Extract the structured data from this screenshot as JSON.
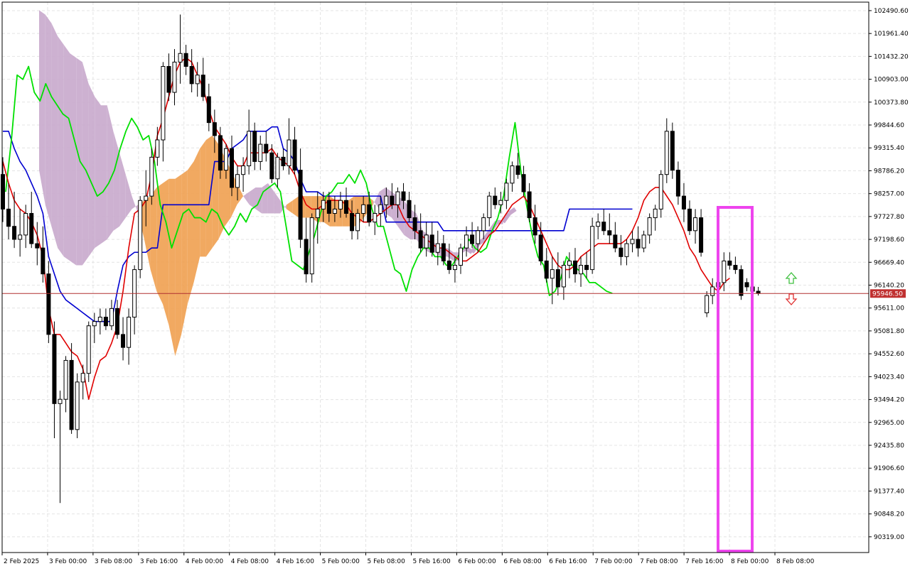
{
  "chart_data": {
    "type": "candlestick",
    "title": "",
    "xlabel": "",
    "ylabel": "",
    "ylim": [
      89955,
      102687
    ],
    "grid": true,
    "y_tick_labels": [
      "102490.60",
      "101961.40",
      "101432.20",
      "100903.00",
      "100373.80",
      "99844.60",
      "99315.40",
      "98786.20",
      "98257.00",
      "97727.80",
      "97198.60",
      "96669.40",
      "96140.20",
      "95611.00",
      "95081.80",
      "94552.60",
      "94023.40",
      "93494.20",
      "92965.00",
      "92435.80",
      "91906.60",
      "91377.40",
      "90848.20",
      "90319.00"
    ],
    "x_tick_labels": [
      "2 Feb 2025",
      "3 Feb 00:00",
      "3 Feb 08:00",
      "3 Feb 16:00",
      "4 Feb 00:00",
      "4 Feb 08:00",
      "4 Feb 16:00",
      "5 Feb 00:00",
      "5 Feb 08:00",
      "5 Feb 16:00",
      "6 Feb 00:00",
      "6 Feb 08:00",
      "6 Feb 16:00",
      "7 Feb 00:00",
      "7 Feb 08:00",
      "7 Feb 16:00",
      "8 Feb 00:00",
      "8 Feb 08:00"
    ],
    "current_price_label": "95946.50",
    "current_price": 95946.5,
    "colors": {
      "tenkan": "#e00000",
      "kijun": "#0000d0",
      "chikou": "#00e000",
      "kumo_bearish": "#c8a8cc",
      "kumo_bullish": "#f0a050",
      "price_line": "#b03030",
      "highlight_box": "#ee44ee",
      "arrow_up": "#40c040",
      "arrow_down": "#e03030",
      "candle_down": "#000000",
      "candle_up": "#ffffff"
    },
    "candles": [
      [
        98700,
        99100,
        97600,
        97900
      ],
      [
        97900,
        98500,
        97200,
        97500
      ],
      [
        97500,
        98300,
        97000,
        97200
      ],
      [
        97200,
        97900,
        96800,
        97300
      ],
      [
        97300,
        98000,
        97000,
        97800
      ],
      [
        97800,
        98300,
        97000,
        97100
      ],
      [
        97100,
        97600,
        96600,
        97000
      ],
      [
        97000,
        97500,
        96200,
        96400
      ],
      [
        96400,
        96700,
        94800,
        95000
      ],
      [
        95000,
        95300,
        92600,
        93400
      ],
      [
        93400,
        93700,
        91100,
        93500
      ],
      [
        93500,
        94500,
        93200,
        94400
      ],
      [
        94400,
        94800,
        92700,
        92800
      ],
      [
        92800,
        94100,
        92600,
        93900
      ],
      [
        93900,
        94300,
        93500,
        94100
      ],
      [
        94100,
        95300,
        93900,
        95200
      ],
      [
        95200,
        95500,
        94800,
        95300
      ],
      [
        95300,
        95600,
        95000,
        95400
      ],
      [
        95400,
        95600,
        95100,
        95200
      ],
      [
        95200,
        95800,
        95100,
        95600
      ],
      [
        95600,
        95800,
        94900,
        95000
      ],
      [
        95000,
        95400,
        94400,
        94700
      ],
      [
        94700,
        95600,
        94300,
        95400
      ],
      [
        95400,
        96600,
        95000,
        96500
      ],
      [
        96500,
        98200,
        96300,
        98100
      ],
      [
        98100,
        98800,
        97500,
        98200
      ],
      [
        98200,
        99300,
        98000,
        99100
      ],
      [
        99100,
        99800,
        98900,
        99500
      ],
      [
        99500,
        101300,
        99000,
        101200
      ],
      [
        101200,
        101500,
        100400,
        100600
      ],
      [
        100600,
        101600,
        100300,
        101300
      ],
      [
        101300,
        102400,
        100800,
        101500
      ],
      [
        101500,
        101700,
        101000,
        101200
      ],
      [
        101200,
        101600,
        100600,
        100800
      ],
      [
        100800,
        101300,
        100500,
        101000
      ],
      [
        101000,
        101400,
        100400,
        100500
      ],
      [
        100500,
        100800,
        99700,
        99900
      ],
      [
        99900,
        100200,
        99200,
        99600
      ],
      [
        99600,
        99800,
        98600,
        98800
      ],
      [
        98800,
        99400,
        98600,
        99300
      ],
      [
        99300,
        99600,
        98200,
        98400
      ],
      [
        98400,
        98900,
        98100,
        98700
      ],
      [
        98700,
        99100,
        98300,
        98900
      ],
      [
        98900,
        100200,
        98700,
        99700
      ],
      [
        99700,
        99900,
        98800,
        99000
      ],
      [
        99000,
        99600,
        98800,
        99400
      ],
      [
        99400,
        99700,
        99000,
        99200
      ],
      [
        99200,
        99400,
        98500,
        98600
      ],
      [
        98600,
        99200,
        98400,
        99100
      ],
      [
        99100,
        99300,
        98800,
        98900
      ],
      [
        98900,
        100000,
        98700,
        99500
      ],
      [
        99500,
        99800,
        98700,
        98800
      ],
      [
        98800,
        99300,
        97000,
        97200
      ],
      [
        97200,
        97700,
        96200,
        96400
      ],
      [
        96400,
        97800,
        96200,
        97700
      ],
      [
        97700,
        98300,
        97100,
        97900
      ],
      [
        97900,
        98300,
        97600,
        98100
      ],
      [
        98100,
        98300,
        97600,
        97800
      ],
      [
        97800,
        98200,
        97600,
        97900
      ],
      [
        97900,
        98300,
        97700,
        98100
      ],
      [
        98100,
        98400,
        97700,
        97800
      ],
      [
        97800,
        98100,
        97200,
        97400
      ],
      [
        97400,
        97900,
        97200,
        97800
      ],
      [
        97800,
        98200,
        97600,
        98000
      ],
      [
        98000,
        98300,
        97500,
        97600
      ],
      [
        97600,
        98000,
        97300,
        97800
      ],
      [
        97800,
        98200,
        97500,
        98000
      ],
      [
        98000,
        98400,
        97700,
        98200
      ],
      [
        98200,
        98500,
        97900,
        98000
      ],
      [
        98000,
        98400,
        97700,
        98300
      ],
      [
        98300,
        98500,
        97900,
        98100
      ],
      [
        98100,
        98300,
        97600,
        97700
      ],
      [
        97700,
        98000,
        97200,
        97400
      ],
      [
        97400,
        97800,
        96900,
        97000
      ],
      [
        97000,
        97600,
        96800,
        97300
      ],
      [
        97300,
        97600,
        96800,
        96900
      ],
      [
        96900,
        97400,
        96600,
        97100
      ],
      [
        97100,
        97300,
        96600,
        96700
      ],
      [
        96700,
        97100,
        96400,
        96500
      ],
      [
        96500,
        96800,
        96200,
        96600
      ],
      [
        96600,
        97100,
        96400,
        97000
      ],
      [
        97000,
        97500,
        96800,
        97300
      ],
      [
        97300,
        97600,
        97000,
        97100
      ],
      [
        97100,
        97500,
        96900,
        97400
      ],
      [
        97400,
        97800,
        97200,
        97700
      ],
      [
        97700,
        98300,
        97500,
        98200
      ],
      [
        98200,
        98400,
        97900,
        98000
      ],
      [
        98000,
        98300,
        97800,
        98100
      ],
      [
        98100,
        98600,
        97900,
        98500
      ],
      [
        98500,
        99000,
        98300,
        98900
      ],
      [
        98900,
        99200,
        98600,
        98700
      ],
      [
        98700,
        98900,
        98200,
        98300
      ],
      [
        98300,
        98500,
        97600,
        97700
      ],
      [
        97700,
        98000,
        97100,
        97300
      ],
      [
        97300,
        97600,
        96600,
        96700
      ],
      [
        96700,
        97000,
        96200,
        96300
      ],
      [
        96300,
        96800,
        95700,
        96500
      ],
      [
        96500,
        96900,
        95900,
        96100
      ],
      [
        96100,
        96700,
        95800,
        96600
      ],
      [
        96600,
        96900,
        96300,
        96700
      ],
      [
        96700,
        97000,
        96200,
        96400
      ],
      [
        96400,
        96800,
        96100,
        96600
      ],
      [
        96600,
        96900,
        96300,
        96500
      ],
      [
        96500,
        97700,
        96400,
        97500
      ],
      [
        97500,
        97800,
        97200,
        97600
      ],
      [
        97600,
        97900,
        97300,
        97400
      ],
      [
        97400,
        97800,
        97100,
        97300
      ],
      [
        97300,
        97600,
        96900,
        97000
      ],
      [
        97000,
        97300,
        96600,
        96800
      ],
      [
        96800,
        97200,
        96600,
        97100
      ],
      [
        97100,
        97400,
        96900,
        97200
      ],
      [
        97200,
        97500,
        96800,
        97000
      ],
      [
        97000,
        97400,
        96900,
        97300
      ],
      [
        97300,
        97800,
        97100,
        97700
      ],
      [
        97700,
        98000,
        97400,
        97900
      ],
      [
        97900,
        98800,
        97700,
        98700
      ],
      [
        98700,
        100000,
        98500,
        99700
      ],
      [
        99700,
        99900,
        98600,
        98800
      ],
      [
        98800,
        99000,
        98000,
        98200
      ],
      [
        98200,
        98500,
        97600,
        97900
      ],
      [
        97900,
        98100,
        97300,
        97400
      ],
      [
        97400,
        97900,
        97100,
        97700
      ],
      [
        97700,
        97900,
        96800,
        96900
      ],
      [
        95500,
        96000,
        95400,
        95900
      ],
      [
        95900,
        96300,
        95700,
        96100
      ],
      [
        96100,
        96400,
        95900,
        96200
      ],
      [
        96200,
        96900,
        96000,
        96700
      ],
      [
        96700,
        96900,
        96500,
        96600
      ],
      [
        96600,
        96800,
        96400,
        96500
      ],
      [
        96500,
        96600,
        95800,
        95900
      ],
      [
        96200,
        96300,
        96000,
        96100
      ],
      [
        96100,
        96200,
        95900,
        96000
      ],
      [
        96000,
        96100,
        95900,
        95950
      ]
    ],
    "tenkan": [
      99000,
      98500,
      98100,
      97900,
      97800,
      97600,
      97300,
      96800,
      95600,
      95000,
      95000,
      94800,
      94600,
      94500,
      94200,
      93500,
      94000,
      94400,
      94500,
      94800,
      95200,
      96000,
      97000,
      97800,
      97900,
      98100,
      98700,
      99600,
      100000,
      100500,
      101000,
      101300,
      101400,
      101300,
      101000,
      100700,
      100200,
      99800,
      99600,
      99400,
      99100,
      98900,
      98900,
      99200,
      99200,
      99200,
      99200,
      99300,
      99100,
      99000,
      98900,
      98700,
      98300,
      98000,
      97900,
      97900,
      98000,
      98100,
      98100,
      98100,
      98000,
      97800,
      97700,
      97600,
      97600,
      97700,
      97800,
      97900,
      98000,
      98000,
      97700,
      97500,
      97400,
      97300,
      97200,
      97100,
      97000,
      97000,
      96900,
      96800,
      96700,
      96700,
      96800,
      96900,
      97100,
      97300,
      97400,
      97600,
      97800,
      98000,
      98100,
      98200,
      98000,
      97700,
      97400,
      97100,
      96800,
      96600,
      96500,
      96500,
      96600,
      96800,
      96900,
      97000,
      97100,
      97100,
      97100,
      97100,
      97100,
      97200,
      97400,
      97700,
      98100,
      98300,
      98400,
      98400,
      98200,
      98000,
      97700,
      97400,
      97000,
      96800,
      96500,
      96300,
      96100,
      96000,
      96200,
      96300
    ],
    "kijun": [
      99700,
      99700,
      99300,
      99000,
      98800,
      98500,
      98200,
      97800,
      96800,
      96400,
      96000,
      95800,
      95700,
      95600,
      95500,
      95400,
      95300,
      95300,
      95300,
      95300,
      96000,
      96600,
      96800,
      96900,
      96900,
      96900,
      97000,
      97000,
      98000,
      98000,
      98000,
      98000,
      98000,
      98000,
      98000,
      98000,
      98000,
      99000,
      99000,
      99000,
      99300,
      99400,
      99500,
      99700,
      99700,
      99700,
      99700,
      99800,
      99800,
      99300,
      99200,
      99000,
      98600,
      98300,
      98300,
      98300,
      98200,
      98200,
      98200,
      98200,
      98200,
      98200,
      98200,
      98200,
      98200,
      98200,
      98200,
      97600,
      97600,
      97600,
      97600,
      97600,
      97600,
      97600,
      97600,
      97600,
      97600,
      97400,
      97400,
      97400,
      97400,
      97400,
      97400,
      97400,
      97400,
      97400,
      97400,
      97400,
      97400,
      97400,
      97400,
      97400,
      97400,
      97400,
      97400,
      97400,
      97400,
      97400,
      97400,
      97900,
      97900,
      97900,
      97900,
      97900,
      97900,
      97900,
      97900,
      97900,
      97900,
      97900,
      97900
    ],
    "chikou": [
      98300,
      99500,
      101000,
      100900,
      101200,
      100600,
      100400,
      100800,
      100500,
      100300,
      100100,
      100000,
      99500,
      99000,
      98800,
      98500,
      98200,
      98300,
      98500,
      98800,
      99300,
      99700,
      100000,
      99800,
      99500,
      99600,
      99000,
      98000,
      97600,
      97000,
      97400,
      97800,
      97900,
      97700,
      97700,
      97600,
      97900,
      97800,
      97500,
      97300,
      97500,
      97800,
      97600,
      97900,
      98000,
      98300,
      98400,
      98500,
      98300,
      97500,
      96700,
      96600,
      96500,
      96900,
      97300,
      97800,
      98200,
      98300,
      98500,
      98500,
      98700,
      98500,
      98800,
      98500,
      97900,
      97500,
      97500,
      97000,
      96500,
      96400,
      96000,
      96500,
      96800,
      97000,
      97000,
      96800,
      96800,
      96600,
      96600,
      96800,
      97000,
      97200,
      97000,
      96900,
      97000,
      97400,
      97700,
      98200,
      99100,
      99900,
      98800,
      98000,
      97300,
      96800,
      96600,
      95900,
      96000,
      96300,
      96800,
      96600,
      96500,
      96400,
      96200,
      96200,
      96100,
      96000,
      95950
    ],
    "senkou_a": [
      98800,
      98000,
      97500,
      97000,
      96800,
      96700,
      96600,
      96600,
      96800,
      97000,
      97100,
      97200,
      97400,
      97500,
      97700,
      97900,
      98000,
      98100,
      98200,
      98400,
      98500,
      98600,
      98600,
      98700,
      98800,
      99000,
      99300,
      99500,
      99600,
      99400,
      99100,
      98800,
      98500,
      98200,
      98000,
      97900,
      97800,
      97800,
      97800,
      97800,
      98000,
      98100,
      98200,
      98200,
      98200,
      98200,
      98200,
      98200,
      98100,
      98100,
      98100,
      98200,
      98200,
      98200,
      98100,
      97900,
      97800,
      97700,
      97500,
      97300,
      97200,
      97200,
      97000,
      96900,
      96900,
      96800,
      96800,
      96700,
      96700
    ],
    "senkou_b": [
      102500,
      102400,
      102200,
      101900,
      101700,
      101500,
      101400,
      101300,
      100800,
      100500,
      100300,
      100300,
      99700,
      99200,
      98700,
      98200,
      97800,
      97200,
      96500,
      96000,
      95700,
      95200,
      94500,
      95000,
      95700,
      96200,
      96800,
      96800,
      97000,
      97200,
      97500,
      97700,
      98000,
      98200,
      98300,
      98400,
      98400,
      98500,
      98300,
      98100,
      97900,
      97800,
      97700,
      97700,
      97700,
      97600,
      97600,
      97500,
      97500,
      97500,
      97500,
      97500,
      97600,
      97800,
      98000,
      98300,
      98400,
      98300,
      98200,
      98100,
      97900,
      97800,
      97400,
      97300,
      97100,
      97000,
      97000,
      96900,
      96900,
      97000,
      96900,
      97100,
      97200,
      97400,
      97600,
      97600,
      97800,
      97900
    ],
    "annotation": "highlight box over last candles",
    "signal_arrows": [
      "up",
      "down"
    ]
  }
}
